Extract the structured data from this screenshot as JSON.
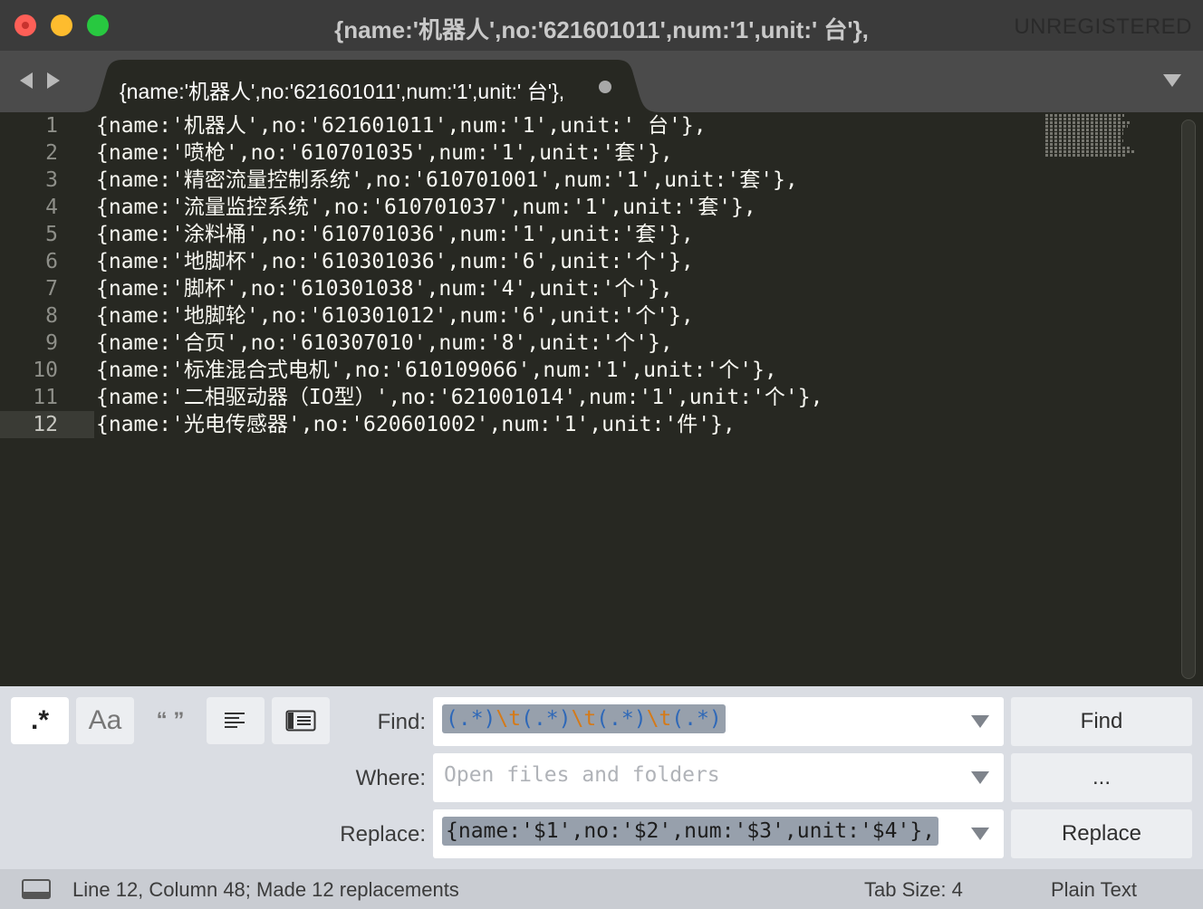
{
  "window": {
    "title": "{name:'机器人',no:'621601011',num:'1',unit:' 台'},",
    "unregistered": "UNREGISTERED"
  },
  "tab": {
    "title": "{name:'机器人',no:'621601011',num:'1',unit:' 台'},",
    "modified": true
  },
  "editor": {
    "current_line": 12,
    "lines": [
      {
        "num": "1",
        "text": "{name:'机器人',no:'621601011',num:'1',unit:' 台'},"
      },
      {
        "num": "2",
        "text": "{name:'喷枪',no:'610701035',num:'1',unit:'套'},"
      },
      {
        "num": "3",
        "text": "{name:'精密流量控制系统',no:'610701001',num:'1',unit:'套'},"
      },
      {
        "num": "4",
        "text": "{name:'流量监控系统',no:'610701037',num:'1',unit:'套'},"
      },
      {
        "num": "5",
        "text": "{name:'涂料桶',no:'610701036',num:'1',unit:'套'},"
      },
      {
        "num": "6",
        "text": "{name:'地脚杯',no:'610301036',num:'6',unit:'个'},"
      },
      {
        "num": "7",
        "text": "{name:'脚杯',no:'610301038',num:'4',unit:'个'},"
      },
      {
        "num": "8",
        "text": "{name:'地脚轮',no:'610301012',num:'6',unit:'个'},"
      },
      {
        "num": "9",
        "text": "{name:'合页',no:'610307010',num:'8',unit:'个'},"
      },
      {
        "num": "10",
        "text": "{name:'标准混合式电机',no:'610109066',num:'1',unit:'个'},"
      },
      {
        "num": "11",
        "text": "{name:'二相驱动器（IO型）',no:'621001014',num:'1',unit:'个'},"
      },
      {
        "num": "12",
        "text": "{name:'光电传感器',no:'620601002',num:'1',unit:'件'},"
      }
    ]
  },
  "find_panel": {
    "options": {
      "regex": ".*",
      "case": "Aa",
      "whole_word": "“ ”"
    },
    "find_label": "Find:",
    "find_tokens": [
      {
        "t": "(.*)",
        "k": "g"
      },
      {
        "t": "\\t",
        "k": "t"
      },
      {
        "t": "(.*)",
        "k": "g"
      },
      {
        "t": "\\t",
        "k": "t"
      },
      {
        "t": "(.*)",
        "k": "g"
      },
      {
        "t": "\\t",
        "k": "t"
      },
      {
        "t": "(.*)",
        "k": "g"
      }
    ],
    "where_label": "Where:",
    "where_placeholder": "Open files and folders",
    "replace_label": "Replace:",
    "replace_value": "{name:'$1',no:'$2',num:'$3',unit:'$4'},",
    "find_button": "Find",
    "where_button": "...",
    "replace_button": "Replace",
    "colors": {
      "group": "#2e68b8",
      "tab_escape": "#d57a18"
    }
  },
  "status": {
    "position": "Line 12, Column 48; Made 12 replacements",
    "tab_size": "Tab Size: 4",
    "syntax": "Plain Text"
  }
}
